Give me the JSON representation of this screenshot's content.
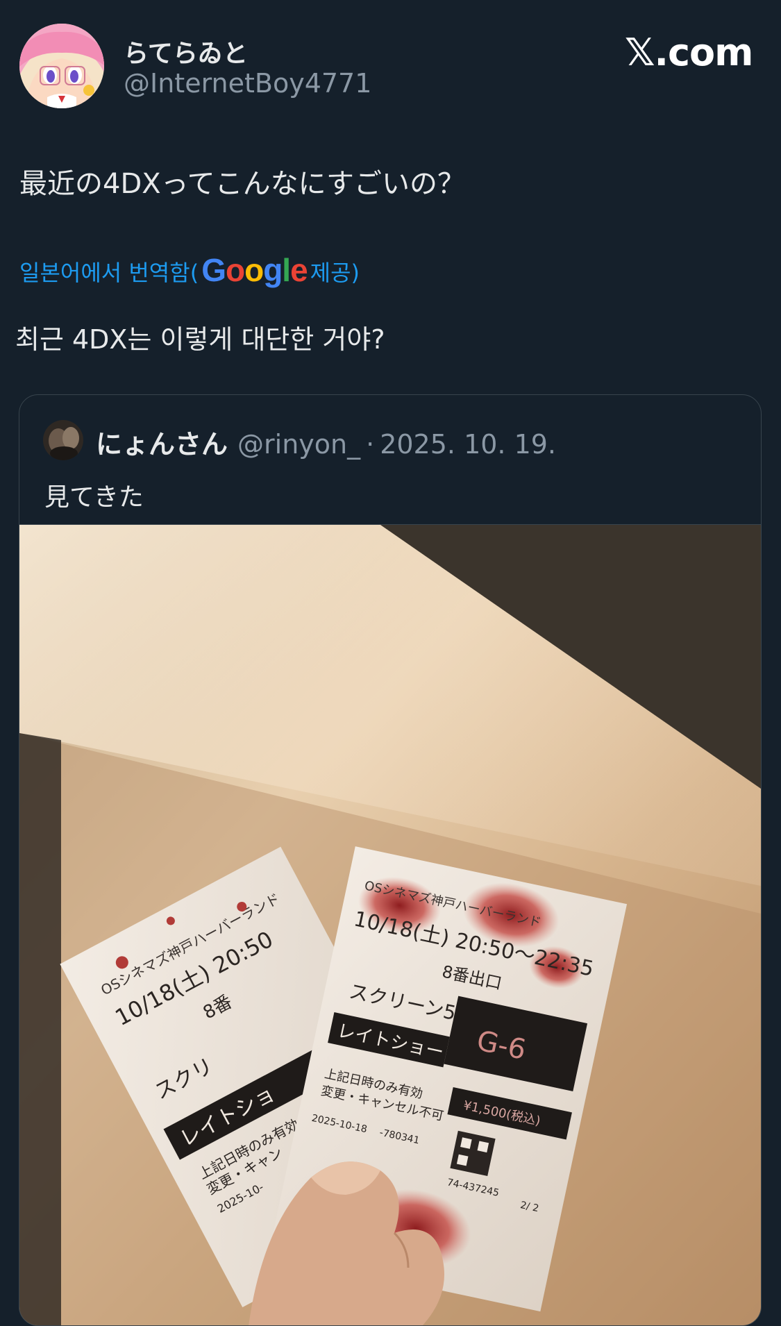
{
  "author": {
    "display_name": "らてらゐと",
    "handle": "@InternetBoy4771"
  },
  "brand": {
    "label": "𝕏.com"
  },
  "tweet": {
    "text": "最近の4DXってこんなにすごいの？",
    "translation_prefix": "일본어에서 번역함(",
    "translation_provider": "Google",
    "translation_suffix": " 제공)",
    "translated_text": "최근 4DX는 이렇게 대단한 거야?"
  },
  "quoted_tweet": {
    "display_name": "にょんさん",
    "handle": "@rinyon_",
    "separator": "·",
    "date": "2025. 10. 19.",
    "text": "見てきた"
  },
  "photo": {
    "ticket_front": {
      "theater": "OSシネマズ神戸ハーバーランド",
      "datetime": "10/18(土) 20:50〜22:35",
      "exit": "8番出口",
      "screen": "スクリーン5",
      "seat": "G-6",
      "show_type": "レイトショー",
      "note_1": "上記日時のみ有効",
      "note_2": "変更・キャンセル不可",
      "price": "¥1,500(税込)",
      "issued": "2025-10-18",
      "ticket_no": "-780341",
      "code": "74-437245",
      "page": "2/ 2"
    },
    "ticket_back": {
      "theater": "OSシネマズ神戸ハーバーランド",
      "datetime": "10/18(土) 20:50",
      "exit": "8番",
      "screen": "スクリ",
      "show_type": "レイトショ",
      "note_1": "上記日時のみ有効",
      "note_2": "変更・キャン",
      "issued": "2025-10-"
    }
  },
  "colors": {
    "background": "#15202b",
    "primary_text": "#e7e9ea",
    "secondary_text": "#8b98a5",
    "link": "#1d9bf0",
    "border": "#38444d",
    "google_blue": "#4285f4",
    "google_red": "#ea4335",
    "google_yellow": "#fbbc05",
    "google_green": "#34a853"
  }
}
